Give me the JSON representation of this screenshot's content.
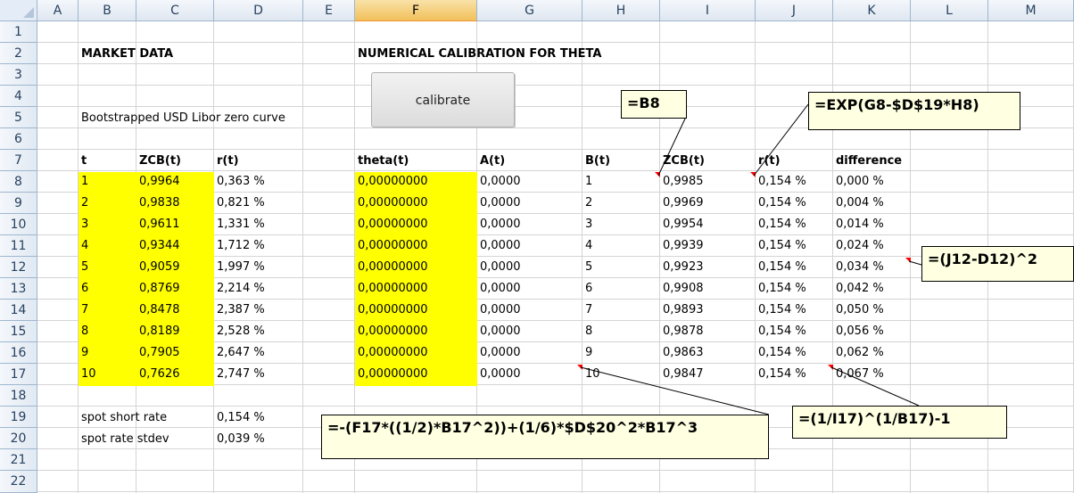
{
  "columns": [
    "A",
    "B",
    "C",
    "D",
    "E",
    "F",
    "G",
    "H",
    "I",
    "J",
    "K",
    "L",
    "M"
  ],
  "rows": [
    "1",
    "2",
    "3",
    "4",
    "5",
    "6",
    "7",
    "8",
    "9",
    "10",
    "11",
    "12",
    "13",
    "14",
    "15",
    "16",
    "17",
    "18",
    "19",
    "20",
    "21",
    "22"
  ],
  "labels": {
    "market_data": "MARKET DATA",
    "numerical_calibration": "NUMERICAL CALIBRATION FOR THETA",
    "bootstrapped": "Bootstrapped USD Libor zero curve",
    "calibrate_button": "calibrate",
    "spot_short_rate": "spot short rate",
    "spot_short_rate_value": "0,154 %",
    "spot_rate_stdev": "spot rate stdev",
    "spot_rate_stdev_value": "0,039 %"
  },
  "headers": {
    "t": "t",
    "zcb": "ZCB(t)",
    "r": "r(t)",
    "theta": "theta(t)",
    "a": "A(t)",
    "bt": "B(t)",
    "zcb2": "ZCB(t)",
    "r2": "r(t)",
    "difference": "difference"
  },
  "table": [
    {
      "t": "1",
      "zcb": "0,9964",
      "r": "0,363 %",
      "theta": "0,00000000",
      "a": "0,0000",
      "bt": "1",
      "zcb2": "0,9985",
      "r2": "0,154 %",
      "diff": "0,000 %"
    },
    {
      "t": "2",
      "zcb": "0,9838",
      "r": "0,821 %",
      "theta": "0,00000000",
      "a": "0,0000",
      "bt": "2",
      "zcb2": "0,9969",
      "r2": "0,154 %",
      "diff": "0,004 %"
    },
    {
      "t": "3",
      "zcb": "0,9611",
      "r": "1,331 %",
      "theta": "0,00000000",
      "a": "0,0000",
      "bt": "3",
      "zcb2": "0,9954",
      "r2": "0,154 %",
      "diff": "0,014 %"
    },
    {
      "t": "4",
      "zcb": "0,9344",
      "r": "1,712 %",
      "theta": "0,00000000",
      "a": "0,0000",
      "bt": "4",
      "zcb2": "0,9939",
      "r2": "0,154 %",
      "diff": "0,024 %"
    },
    {
      "t": "5",
      "zcb": "0,9059",
      "r": "1,997 %",
      "theta": "0,00000000",
      "a": "0,0000",
      "bt": "5",
      "zcb2": "0,9923",
      "r2": "0,154 %",
      "diff": "0,034 %"
    },
    {
      "t": "6",
      "zcb": "0,8769",
      "r": "2,214 %",
      "theta": "0,00000000",
      "a": "0,0000",
      "bt": "6",
      "zcb2": "0,9908",
      "r2": "0,154 %",
      "diff": "0,042 %"
    },
    {
      "t": "7",
      "zcb": "0,8478",
      "r": "2,387 %",
      "theta": "0,00000000",
      "a": "0,0000",
      "bt": "7",
      "zcb2": "0,9893",
      "r2": "0,154 %",
      "diff": "0,050 %"
    },
    {
      "t": "8",
      "zcb": "0,8189",
      "r": "2,528 %",
      "theta": "0,00000000",
      "a": "0,0000",
      "bt": "8",
      "zcb2": "0,9878",
      "r2": "0,154 %",
      "diff": "0,056 %"
    },
    {
      "t": "9",
      "zcb": "0,7905",
      "r": "2,647 %",
      "theta": "0,00000000",
      "a": "0,0000",
      "bt": "9",
      "zcb2": "0,9863",
      "r2": "0,154 %",
      "diff": "0,062 %"
    },
    {
      "t": "10",
      "zcb": "0,7626",
      "r": "2,747 %",
      "theta": "0,00000000",
      "a": "0,0000",
      "bt": "10",
      "zcb2": "0,9847",
      "r2": "0,154 %",
      "diff": "0,067 %"
    }
  ],
  "notes": {
    "b8": "=B8",
    "exp": "=EXP(G8-$D$19*H8)",
    "diffsq": "=(J12-D12)^2",
    "afunc": "=-(F17*((1/2)*B17^2))+(1/6)*$D$20^2*B17^3",
    "rate": "=(1/I17)^(1/B17)-1"
  },
  "colors": {
    "yellow": "#ffff00",
    "header_bg": "#dfe7f1",
    "selected_col": "#f1c05a",
    "note_bg": "#ffffe1",
    "grid": "#d4d4d4"
  }
}
